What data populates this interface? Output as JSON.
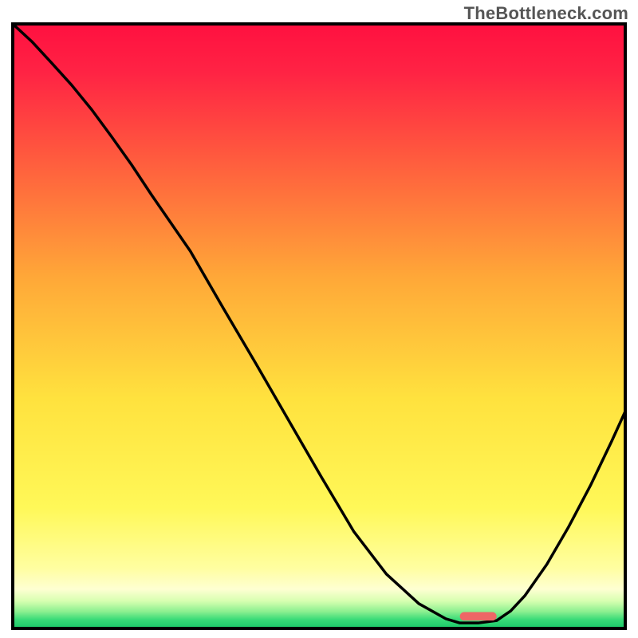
{
  "watermark": "TheBottleneck.com",
  "chart_data": {
    "type": "line",
    "title": "",
    "xlabel": "",
    "ylabel": "",
    "xlim": [
      0,
      100
    ],
    "ylim": [
      0,
      100
    ],
    "grid": false,
    "legend": false,
    "annotations": [],
    "line_color": "#000000",
    "marker": {
      "x": 76,
      "y": 2.0,
      "width": 6,
      "height": 1.4,
      "color": "#ee6666",
      "shape": "rounded-bar"
    },
    "gradient_stops": [
      {
        "offset": 0.0,
        "color": "#ff1040"
      },
      {
        "offset": 0.08,
        "color": "#ff2344"
      },
      {
        "offset": 0.22,
        "color": "#ff5a3e"
      },
      {
        "offset": 0.42,
        "color": "#ffa838"
      },
      {
        "offset": 0.62,
        "color": "#ffe23e"
      },
      {
        "offset": 0.8,
        "color": "#fff858"
      },
      {
        "offset": 0.9,
        "color": "#fffea0"
      },
      {
        "offset": 0.935,
        "color": "#feffd2"
      },
      {
        "offset": 0.955,
        "color": "#d6ffb0"
      },
      {
        "offset": 0.972,
        "color": "#8cf090"
      },
      {
        "offset": 0.985,
        "color": "#3adc78"
      },
      {
        "offset": 1.0,
        "color": "#18c868"
      }
    ],
    "x": [
      0,
      3.1,
      6.3,
      9.6,
      12.9,
      16.1,
      19.4,
      22.6,
      25.8,
      29.0,
      34.3,
      39.7,
      45.0,
      50.3,
      55.7,
      61.0,
      66.3,
      70.7,
      73.0,
      76.0,
      79.0,
      81.3,
      83.6,
      87.2,
      90.7,
      94.3,
      97.8,
      100.0
    ],
    "values": [
      100.0,
      97.1,
      93.6,
      89.9,
      85.8,
      81.4,
      76.7,
      71.8,
      67.1,
      62.4,
      53.1,
      43.8,
      34.5,
      25.2,
      16.0,
      9.0,
      4.1,
      1.6,
      0.9,
      0.9,
      1.3,
      2.9,
      5.4,
      10.6,
      16.7,
      23.6,
      31.0,
      35.9
    ]
  }
}
